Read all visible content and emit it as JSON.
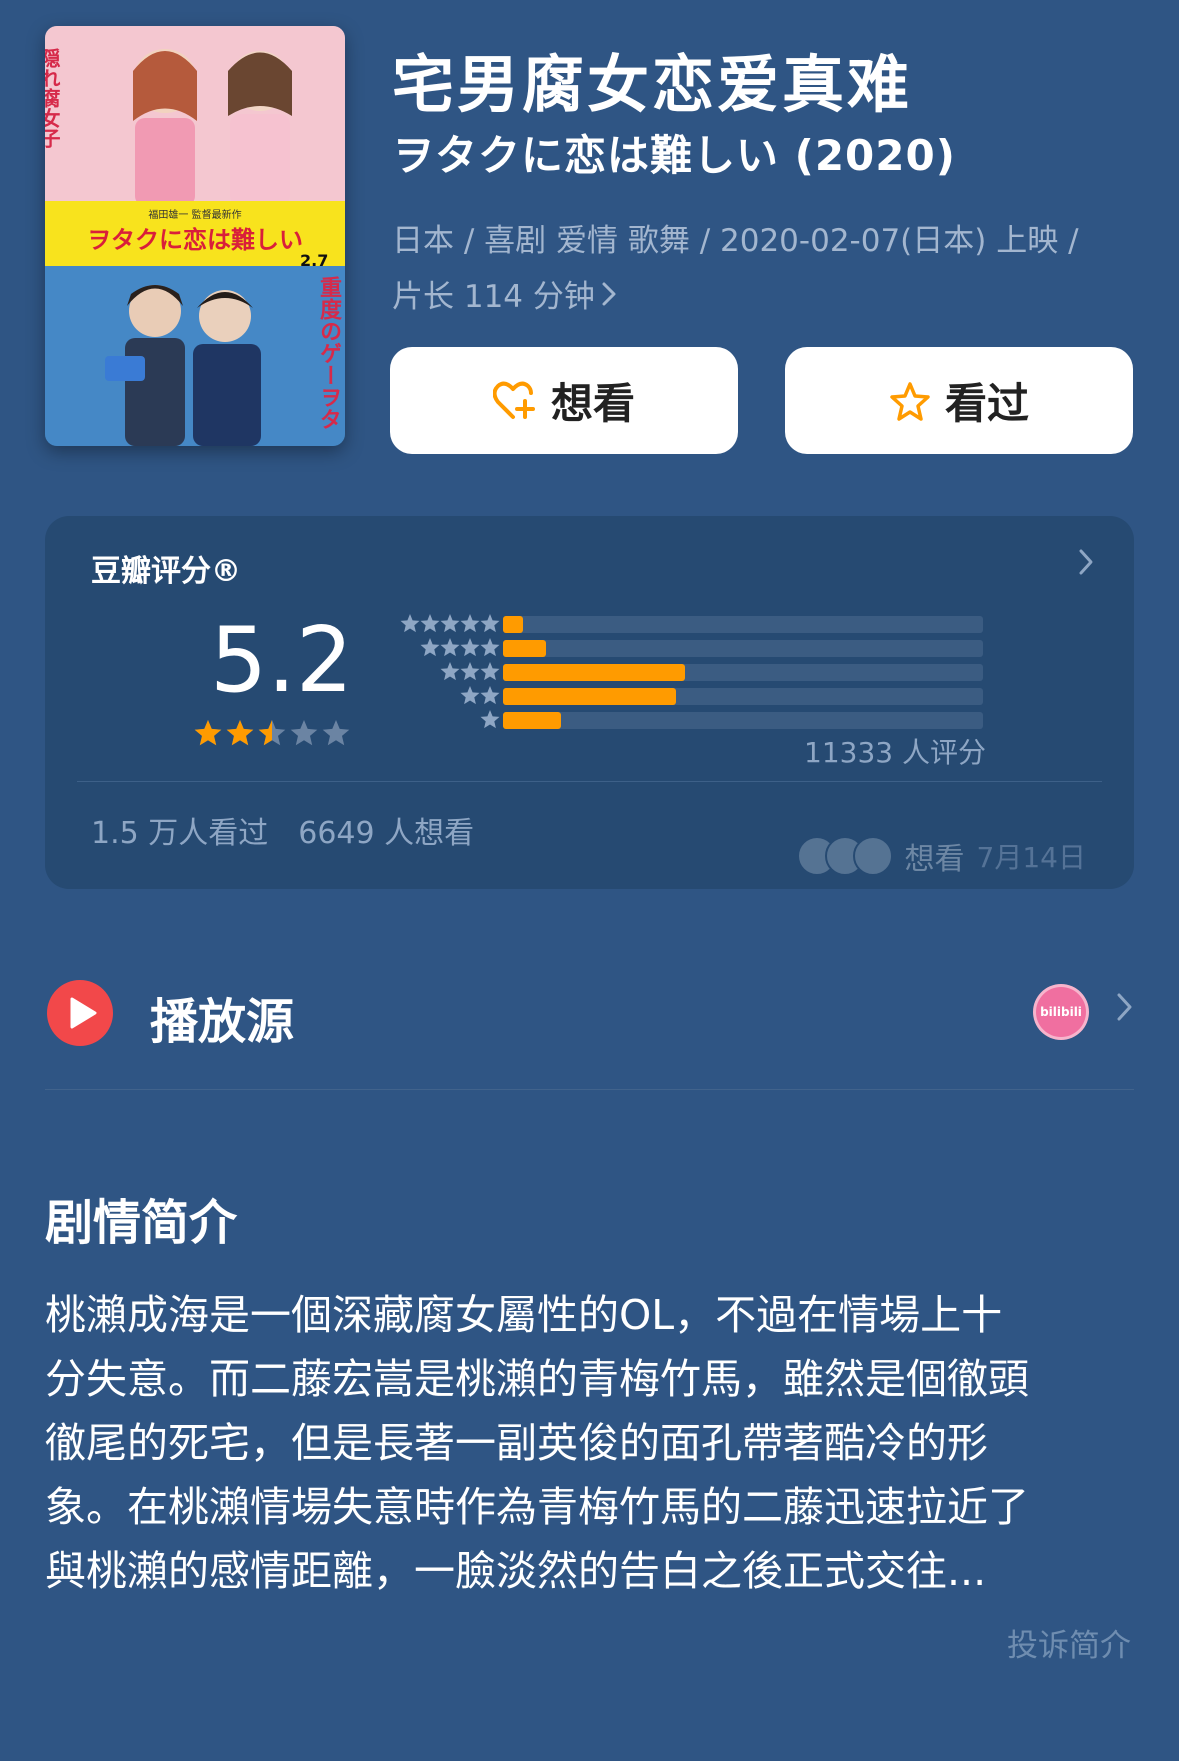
{
  "movie": {
    "title": "宅男腐女恋爱真难",
    "original_title": "ヲタクに恋は難しい (2020)",
    "meta_line1": "日本 / 喜剧 爱情 歌舞 / 2020-02-07(日本) 上映 /",
    "meta_line2": "片长 114 分钟",
    "poster": {
      "text_corner": "隠れ腐女子",
      "text_banner": "ヲタクに恋は難しい",
      "text_director": "福田雄一 監督最新作",
      "text_date": "2.7",
      "text_bottom": "重度のゲーヲタ"
    }
  },
  "actions": {
    "wish_label": "想看",
    "seen_label": "看过",
    "wish_icon": "heart-plus-icon",
    "seen_icon": "star-outline-icon"
  },
  "rating": {
    "label": "豆瓣评分®",
    "score": "5.2",
    "stars": 2.5,
    "distribution_percent": [
      4,
      9,
      38,
      36,
      12
    ],
    "count_text": "11333 人评分",
    "watched_text": "1.5 万人看过",
    "wish_text": "6649 人想看",
    "friend_action": "想看",
    "friend_date": "7月14日"
  },
  "source": {
    "label": "播放源",
    "platform_badge": "bilibili"
  },
  "synopsis": {
    "title": "剧情简介",
    "lines": [
      "桃瀨成海是一個深藏腐女屬性的OL，不過在情場上十",
      "分失意。而二藤宏嵩是桃瀨的青梅竹馬，雖然是個徹頭",
      "徹尾的死宅，但是長著一副英俊的面孔帶著酷冷的形",
      "象。在桃瀨情場失意時作為青梅竹馬的二藤迅速拉近了",
      "與桃瀨的感情距離，一臉淡然的告白之後正式交往..."
    ],
    "report_label": "投诉简介"
  },
  "colors": {
    "background": "#2f5584",
    "card": "#264a72",
    "accent_orange": "#ff9b00",
    "play_red": "#f2484a",
    "muted_text": "#a3b6cf"
  }
}
